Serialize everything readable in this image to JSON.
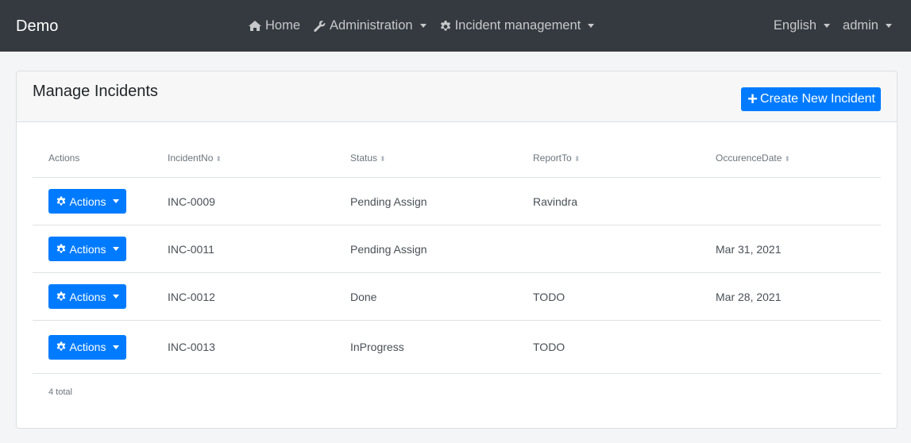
{
  "navbar": {
    "brand": "Demo",
    "home": "Home",
    "administration": "Administration",
    "incident_management": "Incident management",
    "language": "English",
    "user": "admin"
  },
  "card": {
    "title": "Manage Incidents",
    "create_button": "Create New Incident"
  },
  "table": {
    "columns": [
      "Actions",
      "IncidentNo",
      "Status",
      "ReportTo",
      "OccurenceDate"
    ],
    "rows": [
      {
        "action": "Actions",
        "incident_no": "INC-0009",
        "status": "Pending Assign",
        "report_to": "Ravindra",
        "occurence_date": ""
      },
      {
        "action": "Actions",
        "incident_no": "INC-0011",
        "status": "Pending Assign",
        "report_to": "",
        "occurence_date": "Mar 31, 2021"
      },
      {
        "action": "Actions",
        "incident_no": "INC-0012",
        "status": "Done",
        "report_to": "TODO",
        "occurence_date": "Mar 28, 2021"
      },
      {
        "action": "Actions",
        "incident_no": "INC-0013",
        "status": "InProgress",
        "report_to": "TODO",
        "occurence_date": ""
      }
    ]
  },
  "footer": {
    "total": "4 total"
  },
  "colors": {
    "primary": "#007bff",
    "navbar": "#343a40"
  }
}
